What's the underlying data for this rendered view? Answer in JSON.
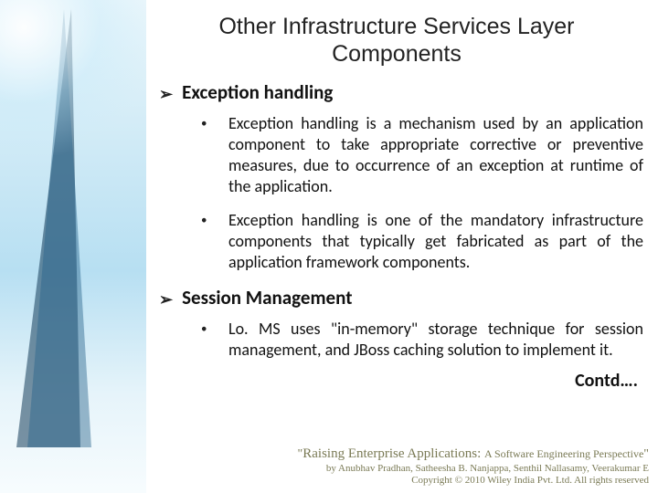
{
  "title": "Other Infrastructure Services Layer Components",
  "sections": [
    {
      "heading": "Exception handling",
      "bullets": [
        "Exception handling is a mechanism used by an application component to take appropriate corrective or preventive measures, due to occurrence of an exception at runtime of the application.",
        "Exception handling is one of the mandatory infrastructure components that typically get fabricated as part of the application framework components."
      ]
    },
    {
      "heading": "Session Management",
      "bullets": [
        "Lo. MS uses \"in-memory\" storage technique for session management, and JBoss caching solution to implement it."
      ]
    }
  ],
  "contd": "Contd….",
  "footer": {
    "title_quote_open": "\"",
    "title_main": "Raising Enterprise Applications: ",
    "title_sub": "A Software Engineering Perspective",
    "title_quote_close": "\"",
    "byline": "by Anubhav Pradhan, Satheesha B. Nanjappa, Senthil Nallasamy, Veerakumar E",
    "copyright": "Copyright © 2010 Wiley India Pvt. Ltd. All rights reserved"
  }
}
